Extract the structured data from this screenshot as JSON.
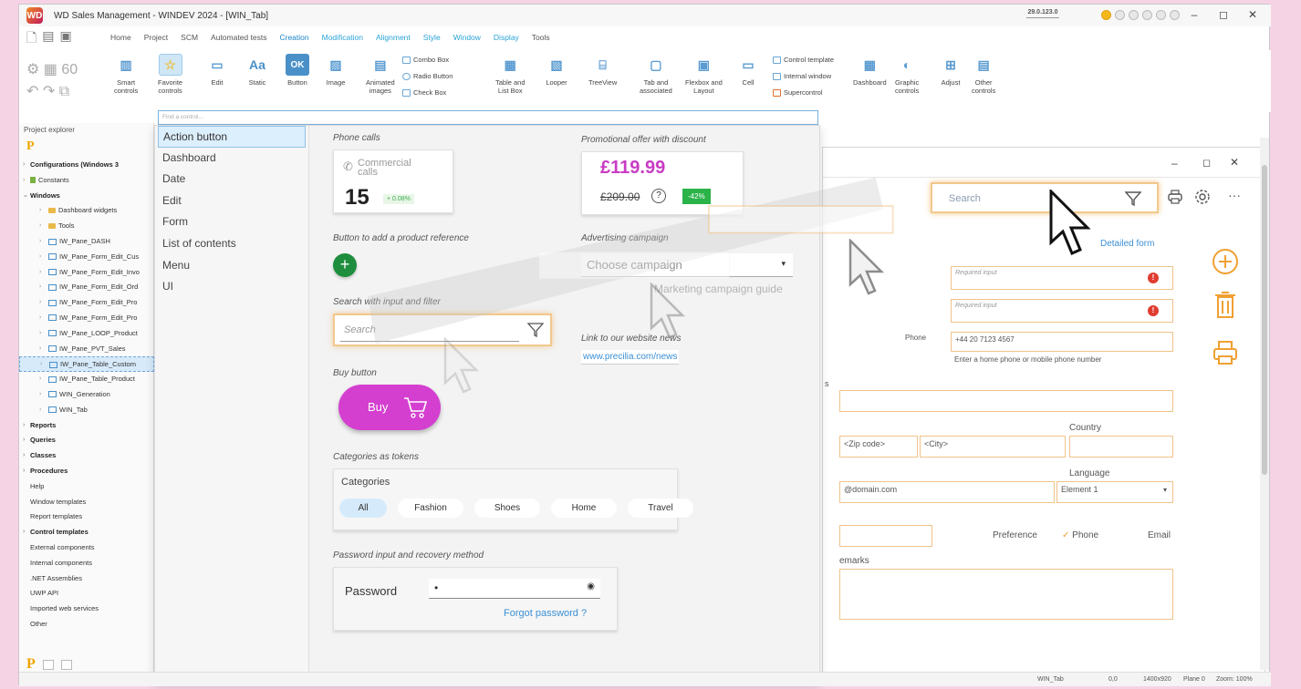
{
  "titlebar": {
    "logo": "WD",
    "title": "WD Sales Management - WINDEV 2024 - [WIN_Tab]",
    "version": "29.0.123.0",
    "minimize": "–",
    "restore": "◻",
    "close": "✕"
  },
  "menu": {
    "items": [
      "Home",
      "Project",
      "SCM",
      "Automated tests",
      "Creation",
      "Modification",
      "Alignment",
      "Style",
      "Window",
      "Display",
      "Tools"
    ],
    "active": "Creation"
  },
  "ribbon": {
    "buttons": [
      {
        "label": "Smart\ncontrols",
        "icon": "smart-controls-icon"
      },
      {
        "label": "Favorite\ncontrols",
        "icon": "star-icon"
      },
      {
        "label": "Edit",
        "icon": "edit-icon"
      },
      {
        "label": "Static",
        "icon": "static-icon"
      },
      {
        "label": "Button",
        "icon": "button-icon"
      },
      {
        "label": "Image",
        "icon": "image-icon"
      },
      {
        "label": "Animated\nimages",
        "icon": "animated-image-icon"
      },
      {
        "label": "Table and\nList Box",
        "icon": "table-icon"
      },
      {
        "label": "Looper",
        "icon": "looper-icon"
      },
      {
        "label": "TreeView",
        "icon": "treeview-icon"
      },
      {
        "label": "Tab and\nassociated",
        "icon": "tab-icon"
      },
      {
        "label": "Flexbox and\nLayout",
        "icon": "flexbox-icon"
      },
      {
        "label": "Cell",
        "icon": "cell-icon"
      },
      {
        "label": "Dashboard",
        "icon": "dashboard-icon"
      },
      {
        "label": "Graphic\ncontrols",
        "icon": "graphic-icon"
      },
      {
        "label": "Adjust",
        "icon": "adjust-icon"
      },
      {
        "label": "Other\ncontrols",
        "icon": "other-icon"
      }
    ],
    "small": {
      "combo": "Combo Box",
      "radio": "Radio Button",
      "check": "Check Box",
      "control_template": "Control template",
      "internal_window": "Internal window",
      "supercontrol": "Supercontrol"
    },
    "ok_label": "OK",
    "aa_label": "Aa"
  },
  "find": {
    "placeholder": "Find a control..."
  },
  "project_explorer": {
    "title": "Project explorer",
    "logo": "P",
    "items": [
      {
        "label": "Configurations (Windows 3",
        "level": 0,
        "bold": true,
        "kind": "node"
      },
      {
        "label": "Constants",
        "level": 0,
        "bold": false,
        "kind": "const"
      },
      {
        "label": "Windows",
        "level": 0,
        "bold": true,
        "kind": "node",
        "open": true
      },
      {
        "label": "Dashboard widgets",
        "level": 1,
        "kind": "folder"
      },
      {
        "label": "Tools",
        "level": 1,
        "kind": "folder"
      },
      {
        "label": "IW_Pane_DASH",
        "level": 1,
        "kind": "win"
      },
      {
        "label": "IW_Pane_Form_Edit_Cus",
        "level": 1,
        "kind": "win"
      },
      {
        "label": "IW_Pane_Form_Edit_Invo",
        "level": 1,
        "kind": "win"
      },
      {
        "label": "IW_Pane_Form_Edit_Ord",
        "level": 1,
        "kind": "win"
      },
      {
        "label": "IW_Pane_Form_Edit_Pro",
        "level": 1,
        "kind": "win"
      },
      {
        "label": "IW_Pane_Form_Edit_Pro",
        "level": 1,
        "kind": "win"
      },
      {
        "label": "IW_Pane_LOOP_Product",
        "level": 1,
        "kind": "win"
      },
      {
        "label": "IW_Pane_PVT_Sales",
        "level": 1,
        "kind": "win"
      },
      {
        "label": "IW_Pane_Table_Custom",
        "level": 1,
        "kind": "win",
        "selected": true
      },
      {
        "label": "IW_Pane_Table_Product",
        "level": 1,
        "kind": "win"
      },
      {
        "label": "WIN_Generation",
        "level": 1,
        "kind": "win"
      },
      {
        "label": "WIN_Tab",
        "level": 1,
        "kind": "win"
      },
      {
        "label": "Reports",
        "level": 0,
        "bold": true,
        "kind": "node"
      },
      {
        "label": "Queries",
        "level": 0,
        "bold": true,
        "kind": "node"
      },
      {
        "label": "Classes",
        "level": 0,
        "bold": true,
        "kind": "node"
      },
      {
        "label": "Procedures",
        "level": 0,
        "bold": true,
        "kind": "node"
      },
      {
        "label": "Help",
        "level": 0,
        "kind": "plain"
      },
      {
        "label": "Window templates",
        "level": 0,
        "kind": "plain"
      },
      {
        "label": "Report templates",
        "level": 0,
        "kind": "plain"
      },
      {
        "label": "Control templates",
        "level": 0,
        "bold": true,
        "kind": "node"
      },
      {
        "label": "External components",
        "level": 0,
        "kind": "plain"
      },
      {
        "label": "Internal components",
        "level": 0,
        "kind": "plain"
      },
      {
        "label": ".NET Assemblies",
        "level": 0,
        "kind": "plain"
      },
      {
        "label": "UWP API",
        "level": 0,
        "kind": "plain"
      },
      {
        "label": "Imported web services",
        "level": 0,
        "kind": "plain"
      },
      {
        "label": "Other",
        "level": 0,
        "kind": "plain"
      }
    ]
  },
  "categories": [
    "Action button",
    "Dashboard",
    "Date",
    "Edit",
    "Form",
    "List of contents",
    "Menu",
    "UI"
  ],
  "selected_category": "Action button",
  "samples": {
    "phone": {
      "section": "Phone calls",
      "label": "Commercial calls",
      "value": "15",
      "delta": "+ 0.08%"
    },
    "promo": {
      "section": "Promotional offer with discount",
      "price": "£119.99",
      "old_price": "£209.00",
      "discount": "-42%"
    },
    "add_ref": {
      "section": "Button to add a product reference"
    },
    "campaign": {
      "section": "Advertising campaign",
      "value": "Choose campaign",
      "ghost": "Search",
      "guide": "Marketing campaign guide"
    },
    "search": {
      "section": "Search with input and filter",
      "placeholder": "Search"
    },
    "link": {
      "section": "Link to our website news",
      "url": "www.precilia.com/news"
    },
    "buy": {
      "section": "Buy button",
      "label": "Buy"
    },
    "tokens": {
      "section": "Categories as tokens",
      "title": "Categories",
      "items": [
        "All",
        "Fashion",
        "Shoes",
        "Home",
        "Travel"
      ]
    },
    "password": {
      "section": "Password input and recovery method",
      "label": "Password",
      "value": "•",
      "forgot": "Forgot password ?"
    }
  },
  "right_window": {
    "search_placeholder": "Search",
    "detailed_link": "Detailed form",
    "required1": "Required input",
    "required2": "Required input",
    "phone_label": "Phone",
    "phone_value": "+44 20 7123 4567",
    "phone_hint": "Enter a home phone or mobile phone number",
    "letter_s": "s",
    "zip": "<Zip code>",
    "city": "<City>",
    "country_label": "Country",
    "email": "@domain.com",
    "language_label": "Language",
    "language_value": "Element 1",
    "preference_label": "Preference",
    "pref_phone": "Phone",
    "pref_email": "Email",
    "remarks_label": "emarks",
    "win_min": "–",
    "win_max": "◻",
    "win_close": "✕"
  },
  "status": {
    "window": "WIN_Tab",
    "coords": "0,0",
    "size": "1400x920",
    "plane": "Plane 0",
    "zoom": "Zoom: 100%"
  },
  "colors": {
    "accent": "#1c85c8",
    "orange": "#f0a033",
    "promo": "#c93cc4",
    "green": "#2bb34a",
    "buy": "#d43fd0"
  }
}
